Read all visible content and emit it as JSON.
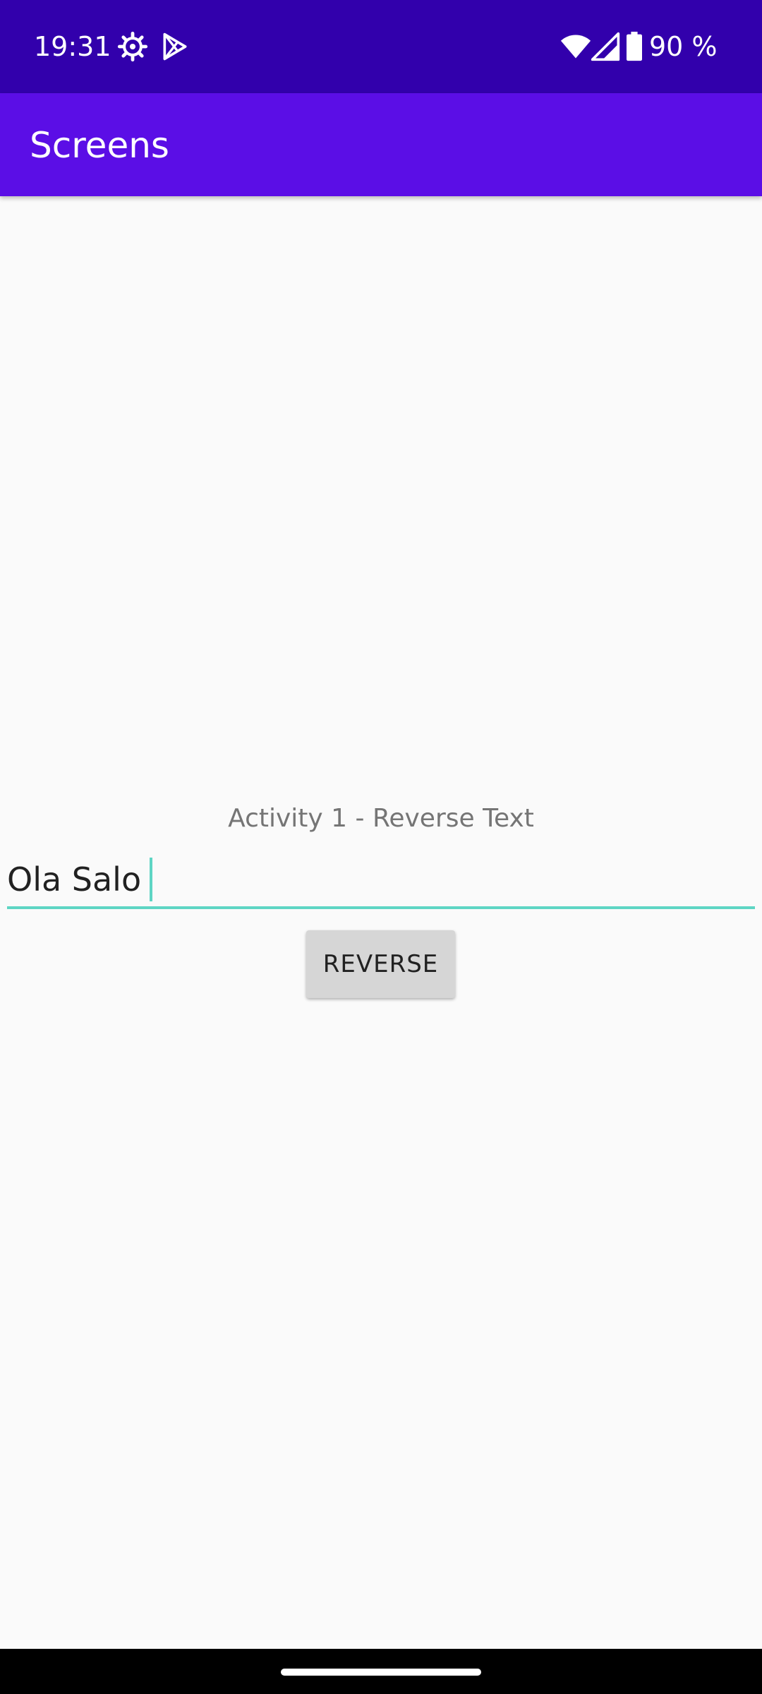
{
  "status_bar": {
    "time": "19:31",
    "battery_text": "90 %",
    "icons": [
      "settings-gear-icon",
      "play-store-icon",
      "wifi-icon",
      "cell-signal-icon",
      "battery-icon"
    ]
  },
  "app_bar": {
    "title": "Screens"
  },
  "main": {
    "activity_label": "Activity 1 - Reverse Text",
    "input_value": "Ola Salo",
    "reverse_button_label": "REVERSE"
  },
  "colors": {
    "status_bar": "#3200ac",
    "app_bar": "#5b0ee6",
    "accent": "#5ed5c4",
    "background": "#fafafa",
    "button": "#d6d6d6"
  }
}
